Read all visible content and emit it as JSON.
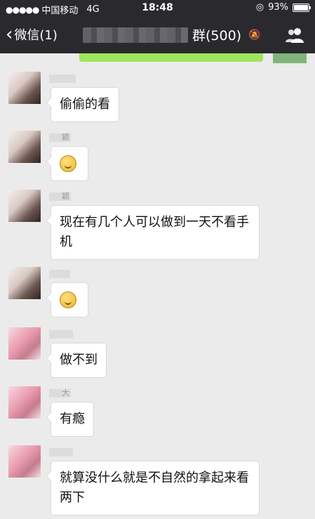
{
  "status_bar": {
    "signal_dots": "●●●●●",
    "carrier": "中国移动",
    "network": "4G",
    "time": "18:48",
    "battery": "93%"
  },
  "nav": {
    "back_label": "微信(1)",
    "group_count": "群(500)",
    "mute_icon": "bell-slash-icon",
    "people_icon": "group-members-icon"
  },
  "messages": [
    {
      "text": "偷偷的看",
      "avatar": "blurred-avatar-1"
    },
    {
      "text": "",
      "emoji": "awkward-smile-emoji",
      "name_tail": "颖"
    },
    {
      "text": "现在有几个人可以做到一天不看手机",
      "name_tail": "颖"
    },
    {
      "text": "",
      "emoji": "wry-smile-emoji"
    },
    {
      "text": "做不到"
    },
    {
      "text": "有瘾",
      "name_tail": "大"
    },
    {
      "text": "就算没什么就是不自然的拿起来看两下"
    }
  ],
  "colors": {
    "nav_bg": "#2a2a2e",
    "chat_bg": "#ebebeb",
    "own_bubble": "#9fe55e",
    "bubble": "#ffffff"
  }
}
